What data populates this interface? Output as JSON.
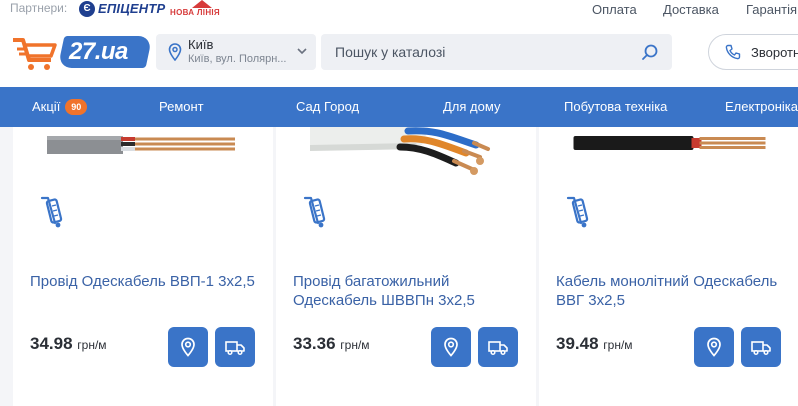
{
  "topbar": {
    "partners_label": "Партнери:",
    "partner_epicentr": "ЕПІЦЕНТР",
    "partner_novalinia": "НОВА ЛІНІЯ",
    "links": [
      "Оплата",
      "Доставка",
      "Гарантія"
    ]
  },
  "header": {
    "logo_text": "27.ua",
    "city": {
      "name": "Київ",
      "address": "Київ, вул. Полярн..."
    },
    "search": {
      "placeholder": "Пошук у каталозі",
      "value": ""
    },
    "callback_label": "Зворотній зв'язок"
  },
  "nav": {
    "items": [
      {
        "label": "Акції",
        "badge": "90"
      },
      {
        "label": "Ремонт"
      },
      {
        "label": "Сад Город"
      },
      {
        "label": "Для дому"
      },
      {
        "label": "Побутова техніка"
      },
      {
        "label": "Електроніка"
      }
    ]
  },
  "products": [
    {
      "title": "Провід Одескабель ВВП-1 3х2,5",
      "price": "34.98",
      "unit": "грн/м"
    },
    {
      "title": "Провід багатожильний Одескабель ШВВПн 3х2,5",
      "price": "33.36",
      "unit": "грн/м"
    },
    {
      "title": "Кабель монолітний Одескабель ВВГ 3х2,5",
      "price": "39.48",
      "unit": "грн/м"
    }
  ],
  "colors": {
    "brand_blue": "#3a74c8",
    "accent_orange": "#f0732b",
    "link_blue": "#3a62a6"
  },
  "icons": [
    "epicentr-logo-icon",
    "cart-logo-icon",
    "location-pin-icon",
    "chevron-down-icon",
    "search-icon",
    "phone-icon",
    "opt-cart-icon",
    "store-pin-icon",
    "delivery-truck-icon"
  ]
}
